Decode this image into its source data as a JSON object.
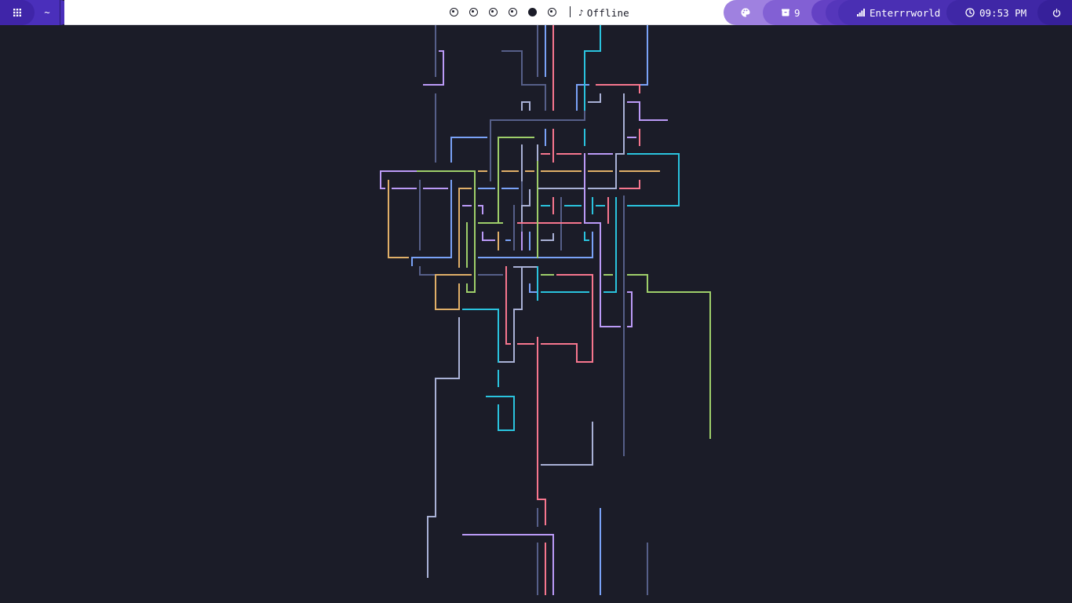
{
  "topbar": {
    "left": {
      "launcher_icon": "grid-apps-icon",
      "terminal_label": "~"
    },
    "workspaces": [
      {
        "index": 1,
        "state": "inactive"
      },
      {
        "index": 2,
        "state": "inactive"
      },
      {
        "index": 3,
        "state": "inactive"
      },
      {
        "index": 4,
        "state": "inactive"
      },
      {
        "index": 5,
        "state": "active"
      },
      {
        "index": 6,
        "state": "inactive"
      }
    ],
    "music": {
      "icon": "music-note-icon",
      "status": "Offline"
    },
    "right": {
      "theme_icon": "palette-icon",
      "packages_icon": "package-icon",
      "packages_count": "9",
      "network_icon": "signal-icon",
      "network_name": "Enterrrworld",
      "clock_icon": "clock-icon",
      "time": "09:53 PM",
      "power_icon": "power-icon"
    }
  },
  "colors": {
    "background": "#1b1c28",
    "bar_white": "#ffffff",
    "accent_purple": "#4a2fbb",
    "line_red": "#f7768e",
    "line_blue": "#7aa2f7",
    "line_green": "#9ece6a",
    "line_cyan": "#2ac3de",
    "line_purple": "#bb9af7",
    "line_orange": "#e0af68",
    "line_gray": "#565f89",
    "line_lightgray": "#a9b1d6"
  },
  "wallpaper": {
    "type": "pipes-screensaver"
  }
}
